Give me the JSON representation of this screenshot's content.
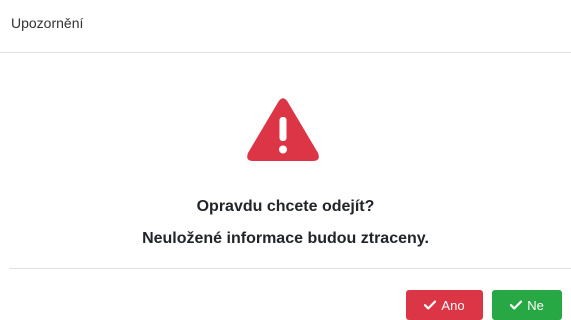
{
  "dialog": {
    "title": "Upozornění",
    "icon": "warning-triangle-icon",
    "icon_color": "#dc3545",
    "message_line_1": "Opravdu chcete odejít?",
    "message_line_2": "Neuložené informace budou ztraceny.",
    "buttons": {
      "yes": {
        "label": "Ano",
        "icon": "check-icon",
        "color": "#dc3545"
      },
      "no": {
        "label": "Ne",
        "icon": "check-icon",
        "color": "#28a745"
      }
    }
  }
}
